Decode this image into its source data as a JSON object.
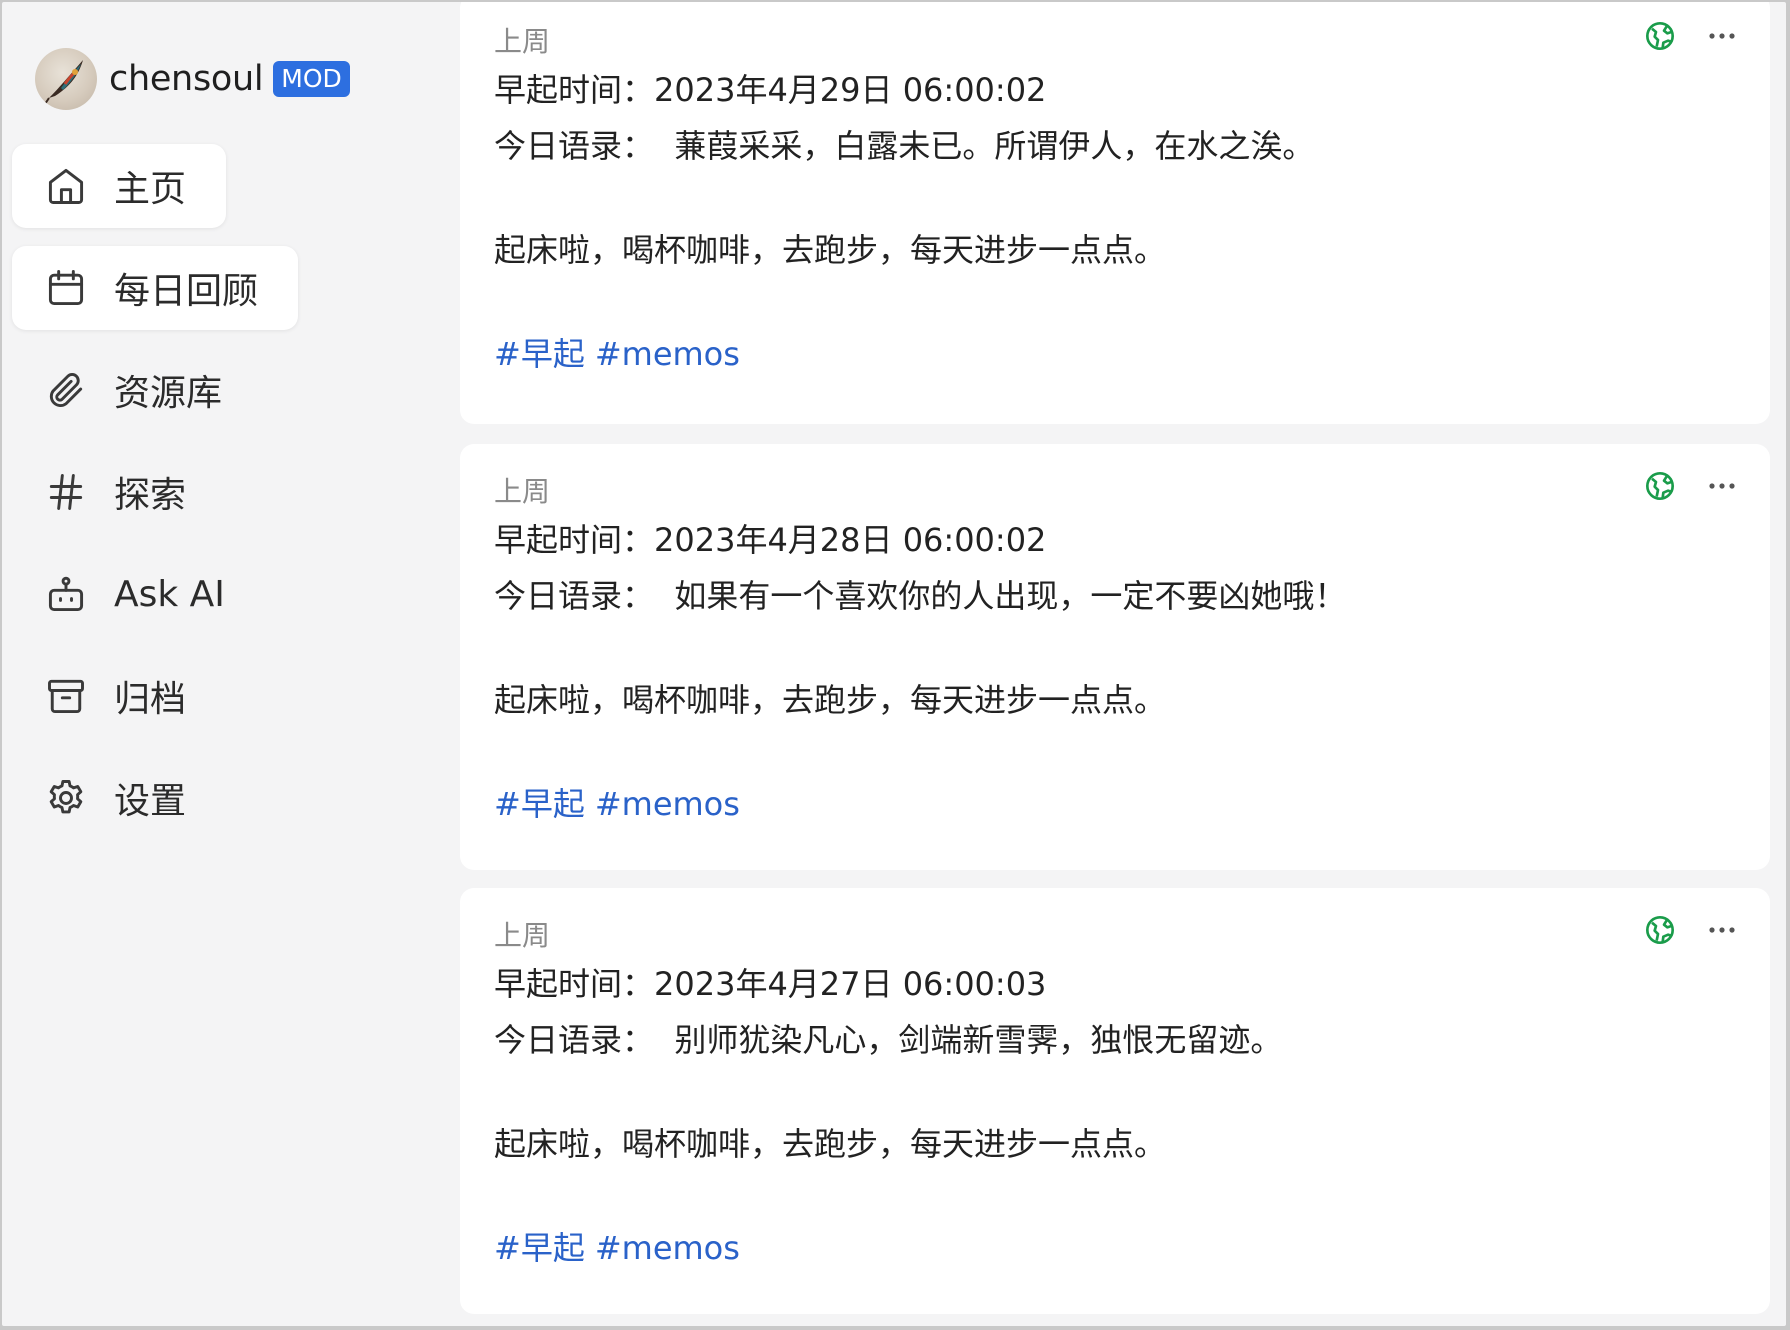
{
  "profile": {
    "username": "chensoul",
    "badge": "MOD"
  },
  "nav": [
    {
      "key": "home",
      "label": "主页",
      "icon": "home-icon"
    },
    {
      "key": "daily-review",
      "label": "每日回顾",
      "icon": "calendar-icon",
      "active": true
    },
    {
      "key": "resources",
      "label": "资源库",
      "icon": "paperclip-icon"
    },
    {
      "key": "explore",
      "label": "探索",
      "icon": "hash-icon"
    },
    {
      "key": "ask-ai",
      "label": "Ask AI",
      "icon": "robot-icon"
    },
    {
      "key": "archive",
      "label": "归档",
      "icon": "archive-icon"
    },
    {
      "key": "settings",
      "label": "设置",
      "icon": "gear-icon"
    }
  ],
  "memos": [
    {
      "time": "上周",
      "wake_line": "早起时间：2023年4月29日 06:00:02",
      "quote_line": "今日语录：  蒹葭采采，白露未已。所谓伊人，在水之涘。",
      "body_line": "起床啦，喝杯咖啡，去跑步，每天进步一点点。",
      "tags": [
        "#早起",
        "#memos"
      ]
    },
    {
      "time": "上周",
      "wake_line": "早起时间：2023年4月28日 06:00:02",
      "quote_line": "今日语录：  如果有一个喜欢你的人出现，一定不要凶她哦！",
      "body_line": "起床啦，喝杯咖啡，去跑步，每天进步一点点。",
      "tags": [
        "#早起",
        "#memos"
      ]
    },
    {
      "time": "上周",
      "wake_line": "早起时间：2023年4月27日 06:00:03",
      "quote_line": "今日语录：  别师犹染凡心，剑端新雪霁，独恨无留迹。",
      "body_line": "起床啦，喝杯咖啡，去跑步，每天进步一点点。",
      "tags": [
        "#早起",
        "#memos"
      ]
    }
  ],
  "colors": {
    "accent": "#2d6fe0",
    "tag": "#2a62c9",
    "visibility_icon": "#1a9c4a"
  },
  "icons": {
    "visibility": "globe-icon",
    "more": "more-icon"
  }
}
